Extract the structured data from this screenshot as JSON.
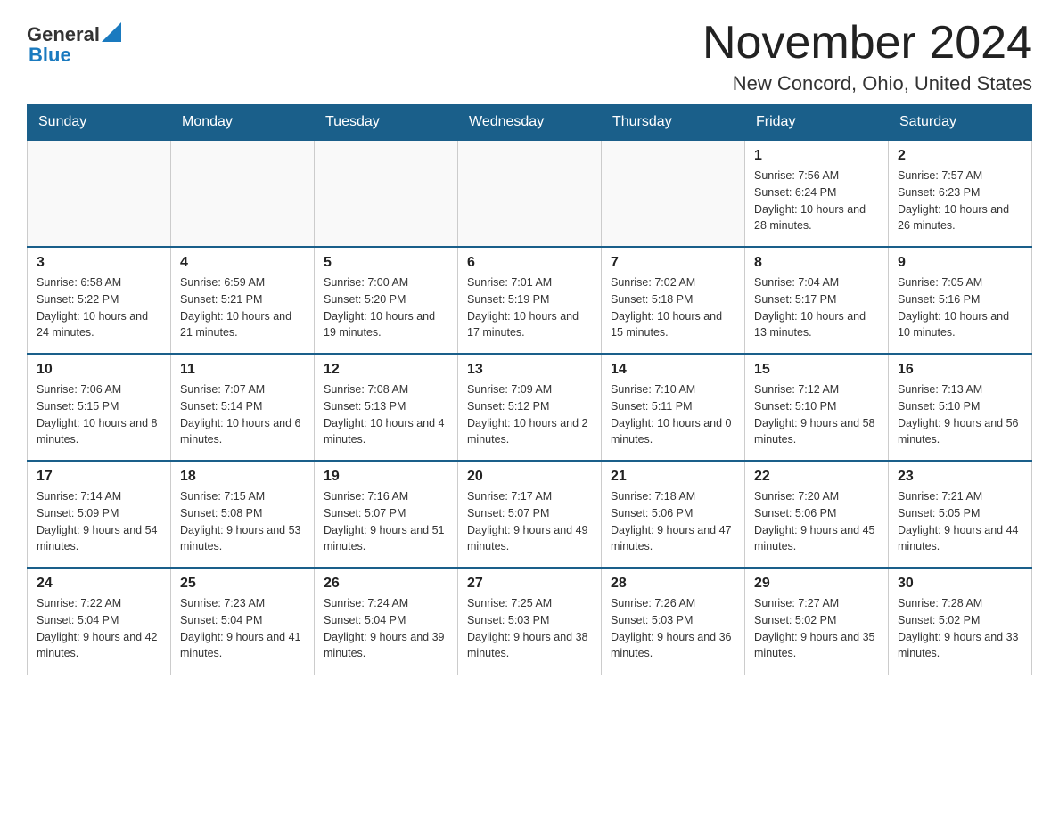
{
  "header": {
    "logo_general": "General",
    "logo_blue": "Blue",
    "calendar_title": "November 2024",
    "location": "New Concord, Ohio, United States"
  },
  "days_of_week": [
    "Sunday",
    "Monday",
    "Tuesday",
    "Wednesday",
    "Thursday",
    "Friday",
    "Saturday"
  ],
  "weeks": [
    [
      {
        "day": "",
        "info": ""
      },
      {
        "day": "",
        "info": ""
      },
      {
        "day": "",
        "info": ""
      },
      {
        "day": "",
        "info": ""
      },
      {
        "day": "",
        "info": ""
      },
      {
        "day": "1",
        "info": "Sunrise: 7:56 AM\nSunset: 6:24 PM\nDaylight: 10 hours and 28 minutes."
      },
      {
        "day": "2",
        "info": "Sunrise: 7:57 AM\nSunset: 6:23 PM\nDaylight: 10 hours and 26 minutes."
      }
    ],
    [
      {
        "day": "3",
        "info": "Sunrise: 6:58 AM\nSunset: 5:22 PM\nDaylight: 10 hours and 24 minutes."
      },
      {
        "day": "4",
        "info": "Sunrise: 6:59 AM\nSunset: 5:21 PM\nDaylight: 10 hours and 21 minutes."
      },
      {
        "day": "5",
        "info": "Sunrise: 7:00 AM\nSunset: 5:20 PM\nDaylight: 10 hours and 19 minutes."
      },
      {
        "day": "6",
        "info": "Sunrise: 7:01 AM\nSunset: 5:19 PM\nDaylight: 10 hours and 17 minutes."
      },
      {
        "day": "7",
        "info": "Sunrise: 7:02 AM\nSunset: 5:18 PM\nDaylight: 10 hours and 15 minutes."
      },
      {
        "day": "8",
        "info": "Sunrise: 7:04 AM\nSunset: 5:17 PM\nDaylight: 10 hours and 13 minutes."
      },
      {
        "day": "9",
        "info": "Sunrise: 7:05 AM\nSunset: 5:16 PM\nDaylight: 10 hours and 10 minutes."
      }
    ],
    [
      {
        "day": "10",
        "info": "Sunrise: 7:06 AM\nSunset: 5:15 PM\nDaylight: 10 hours and 8 minutes."
      },
      {
        "day": "11",
        "info": "Sunrise: 7:07 AM\nSunset: 5:14 PM\nDaylight: 10 hours and 6 minutes."
      },
      {
        "day": "12",
        "info": "Sunrise: 7:08 AM\nSunset: 5:13 PM\nDaylight: 10 hours and 4 minutes."
      },
      {
        "day": "13",
        "info": "Sunrise: 7:09 AM\nSunset: 5:12 PM\nDaylight: 10 hours and 2 minutes."
      },
      {
        "day": "14",
        "info": "Sunrise: 7:10 AM\nSunset: 5:11 PM\nDaylight: 10 hours and 0 minutes."
      },
      {
        "day": "15",
        "info": "Sunrise: 7:12 AM\nSunset: 5:10 PM\nDaylight: 9 hours and 58 minutes."
      },
      {
        "day": "16",
        "info": "Sunrise: 7:13 AM\nSunset: 5:10 PM\nDaylight: 9 hours and 56 minutes."
      }
    ],
    [
      {
        "day": "17",
        "info": "Sunrise: 7:14 AM\nSunset: 5:09 PM\nDaylight: 9 hours and 54 minutes."
      },
      {
        "day": "18",
        "info": "Sunrise: 7:15 AM\nSunset: 5:08 PM\nDaylight: 9 hours and 53 minutes."
      },
      {
        "day": "19",
        "info": "Sunrise: 7:16 AM\nSunset: 5:07 PM\nDaylight: 9 hours and 51 minutes."
      },
      {
        "day": "20",
        "info": "Sunrise: 7:17 AM\nSunset: 5:07 PM\nDaylight: 9 hours and 49 minutes."
      },
      {
        "day": "21",
        "info": "Sunrise: 7:18 AM\nSunset: 5:06 PM\nDaylight: 9 hours and 47 minutes."
      },
      {
        "day": "22",
        "info": "Sunrise: 7:20 AM\nSunset: 5:06 PM\nDaylight: 9 hours and 45 minutes."
      },
      {
        "day": "23",
        "info": "Sunrise: 7:21 AM\nSunset: 5:05 PM\nDaylight: 9 hours and 44 minutes."
      }
    ],
    [
      {
        "day": "24",
        "info": "Sunrise: 7:22 AM\nSunset: 5:04 PM\nDaylight: 9 hours and 42 minutes."
      },
      {
        "day": "25",
        "info": "Sunrise: 7:23 AM\nSunset: 5:04 PM\nDaylight: 9 hours and 41 minutes."
      },
      {
        "day": "26",
        "info": "Sunrise: 7:24 AM\nSunset: 5:04 PM\nDaylight: 9 hours and 39 minutes."
      },
      {
        "day": "27",
        "info": "Sunrise: 7:25 AM\nSunset: 5:03 PM\nDaylight: 9 hours and 38 minutes."
      },
      {
        "day": "28",
        "info": "Sunrise: 7:26 AM\nSunset: 5:03 PM\nDaylight: 9 hours and 36 minutes."
      },
      {
        "day": "29",
        "info": "Sunrise: 7:27 AM\nSunset: 5:02 PM\nDaylight: 9 hours and 35 minutes."
      },
      {
        "day": "30",
        "info": "Sunrise: 7:28 AM\nSunset: 5:02 PM\nDaylight: 9 hours and 33 minutes."
      }
    ]
  ]
}
